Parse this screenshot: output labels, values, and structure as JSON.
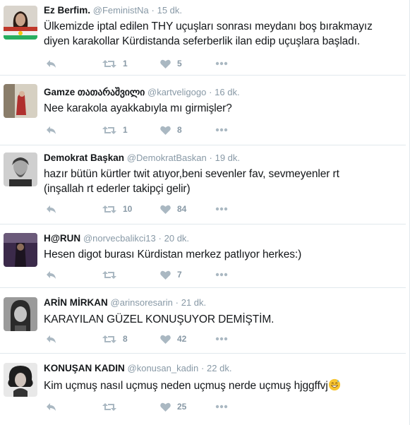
{
  "tweets": [
    {
      "name": "Ez Berfim.",
      "handle": "@FeministNa",
      "dot": "·",
      "time": "15 dk.",
      "text_lines": [
        "Ülkemizde iptal edilen THY uçuşları sonrası meydanı boş bırakmayız",
        "diyen karakollar Kürdistanda seferberlik ilan edip uçuşlara başladı."
      ],
      "retweets": "1",
      "likes": "5"
    },
    {
      "name": "Gamze",
      "name_extra": "თათარაშვილი",
      "handle": "@kartveligogo",
      "dot": "·",
      "time": "16 dk.",
      "text_lines": [
        "Nee karakola ayakkabıyla mı girmişler?"
      ],
      "retweets": "1",
      "likes": "8"
    },
    {
      "name": "Demokrat Başkan",
      "handle": "@DemokratBaskan",
      "dot": "·",
      "time": "19 dk.",
      "text_lines": [
        "hazır bütün kürtler twit atıyor,beni sevenler fav, sevmeyenler rt",
        "(inşallah rt ederler takipçi gelir)"
      ],
      "retweets": "10",
      "likes": "84"
    },
    {
      "name": "H@RUN",
      "handle": "@norvecbalikci13",
      "dot": "·",
      "time": "20 dk.",
      "text_lines": [
        "Hesen digot burası Kürdistan merkez patlıyor herkes:)"
      ],
      "retweets": "",
      "likes": "7"
    },
    {
      "name": "ARİN MİRKAN",
      "handle": "@arinsoresarin",
      "dot": "·",
      "time": "21 dk.",
      "text_lines": [
        "KARAYILAN GÜZEL KONUŞUYOR DEMİŞTİM."
      ],
      "retweets": "8",
      "likes": "42"
    },
    {
      "name": "KONUŞAN KADIN",
      "handle": "@konusan_kadin",
      "dot": "·",
      "time": "22 dk.",
      "text_lines": [
        "Kim uçmuş nasıl uçmuş neden uçmuş nerde uçmuş hjggffvj"
      ],
      "emoji": "grinning-sweat-emoji",
      "retweets": "",
      "likes": "25"
    }
  ],
  "colors": {
    "text": "#14171a",
    "muted": "#8899a6",
    "icon": "#aab8c2",
    "divider": "#e1e8ed"
  }
}
